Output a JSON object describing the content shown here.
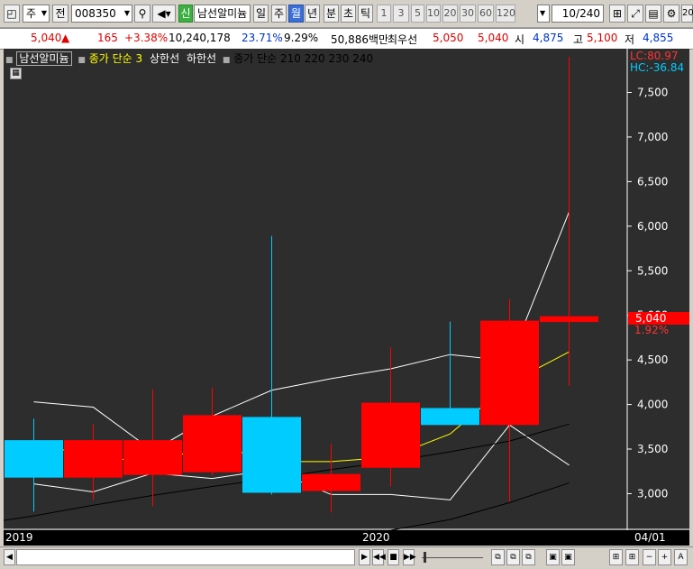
{
  "toolbar": {
    "market": "주",
    "all_btn": "전",
    "code": "008350",
    "credit_badge": "신",
    "stock_name": "남선알미늄",
    "periods": [
      "일",
      "주",
      "월",
      "년",
      "분",
      "초",
      "틱"
    ],
    "active_period": "월",
    "intervals": [
      "1",
      "3",
      "5",
      "10",
      "20",
      "30",
      "60",
      "120"
    ],
    "count": "10",
    "count_total": "/240",
    "edge_text": "20"
  },
  "quote": {
    "price": "5,040",
    "arrow": "▲",
    "change": "165",
    "change_pct": "+3.38%",
    "volume": "10,240,178",
    "ratio1": "23.71%",
    "ratio2": "9.29%",
    "amount": "50,886백만",
    "best_label": "최우선",
    "best_ask": "5,050",
    "best_bid": "5,040",
    "open_label": "시",
    "open": "4,875",
    "high_label": "고",
    "high": "5,100",
    "low_label": "저",
    "low": "4,855"
  },
  "legend": {
    "name": "남선알미늄",
    "ma3": "종가 단순 3",
    "upper": "상한선",
    "lower": "하한선",
    "ma_more": "종가 단순 210  220  230  240"
  },
  "readouts": {
    "lc": "LC:80.97",
    "hc": "HC:-36.84",
    "price_tag": "5,040",
    "pct_tag": "1.92%"
  },
  "colors": {
    "up": "#ff0000",
    "down": "#00ccff",
    "ma3": "#ffff00",
    "band": "#ffffff",
    "long_ma": "#000000",
    "background": "#2d2d2d"
  },
  "chart_data": {
    "type": "candlestick",
    "ylim": [
      2600,
      7950
    ],
    "y_ticks": [
      3000,
      3500,
      4000,
      4500,
      5000,
      5500,
      6000,
      6500,
      7000,
      7500
    ],
    "y_tick_labels": [
      "3,000",
      "3,500",
      "4,000",
      "4,500",
      "5,000",
      "5,500",
      "6,000",
      "6,500",
      "7,000",
      "7,500"
    ],
    "x_labels": [
      {
        "text": "2019",
        "index": 0
      },
      {
        "text": "2020",
        "index": 6
      },
      {
        "text": "04/01",
        "index": 10.7
      }
    ],
    "candles": [
      {
        "open": 3600,
        "close": 3180,
        "high": 3840,
        "low": 2800
      },
      {
        "open": 3180,
        "close": 3600,
        "high": 3780,
        "low": 2930
      },
      {
        "open": 3210,
        "close": 3600,
        "high": 4170,
        "low": 2860
      },
      {
        "open": 3240,
        "close": 3880,
        "high": 4190,
        "low": 3200
      },
      {
        "open": 3860,
        "close": 3010,
        "high": 5890,
        "low": 2990
      },
      {
        "open": 3030,
        "close": 3220,
        "high": 3560,
        "low": 2790
      },
      {
        "open": 3290,
        "close": 4020,
        "high": 4640,
        "low": 3080
      },
      {
        "open": 3960,
        "close": 3770,
        "high": 4930,
        "low": 3770
      },
      {
        "open": 3770,
        "close": 4940,
        "high": 5180,
        "low": 2910
      },
      {
        "open": 4925,
        "close": 4990,
        "high": 7900,
        "low": 4210
      }
    ],
    "series": [
      {
        "name": "종가 단순 3",
        "values": [
          3540,
          3440,
          3330,
          3560,
          3360,
          3360,
          3410,
          3670,
          4240,
          4590
        ]
      },
      {
        "name": "상한선",
        "values": [
          4030,
          3970,
          3480,
          3870,
          4160,
          4290,
          4400,
          4560,
          4490,
          6160
        ]
      },
      {
        "name": "하한선",
        "values": [
          3110,
          3020,
          3230,
          3170,
          3270,
          2990,
          2990,
          2930,
          3770,
          3320
        ]
      },
      {
        "name": "종가 단순 210",
        "values": [
          2750,
          2870,
          2980,
          3080,
          3170,
          3270,
          3360,
          3470,
          3590,
          3780
        ]
      },
      {
        "name": "종가 단순 240",
        "values": [
          null,
          null,
          null,
          null,
          null,
          null,
          2590,
          2710,
          2900,
          3120
        ]
      }
    ]
  }
}
